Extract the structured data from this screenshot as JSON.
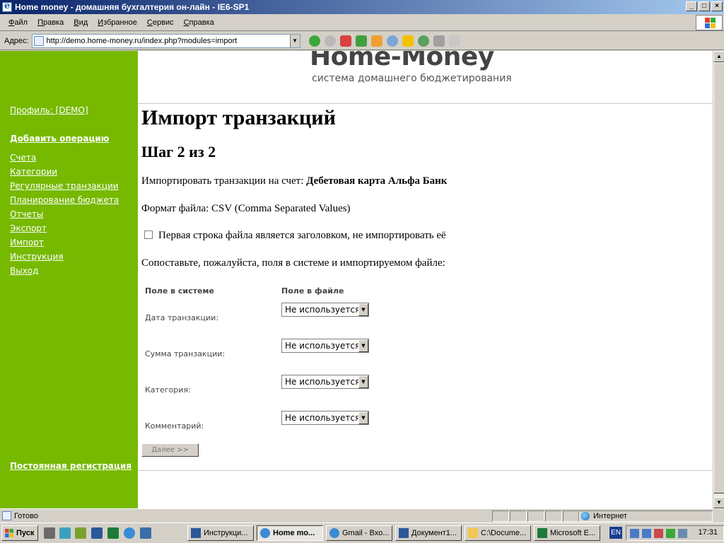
{
  "window": {
    "title": "Home money - домашняя бухгалтерия он-лайн - IE6-SP1",
    "controls": [
      "_",
      "□",
      "×"
    ]
  },
  "menubar": {
    "items": [
      "Файл",
      "Правка",
      "Вид",
      "Избранное",
      "Сервис",
      "Справка"
    ]
  },
  "addressbar": {
    "label": "Адрес:",
    "url": "http://demo.home-money.ru/index.php?modules=import"
  },
  "header": {
    "logo_title": "Home-Money",
    "logo_subtitle": "система домашнего бюджетирования"
  },
  "sidebar": {
    "profile_link": "Профиль: [DEMO]",
    "add_operation": "Добавить операцию",
    "items": [
      "Счета",
      "Категории",
      "Регулярные транзакции",
      "Планирование бюджета",
      "Отчеты",
      "Экспорт",
      "Импорт",
      "Инструкция",
      "Выход"
    ],
    "permanent_registration": "Постоянная регистрация",
    "color": "#76b900"
  },
  "main": {
    "title": "Импорт транзакций",
    "step": "Шаг 2 из 2",
    "account_label": "Импортировать транзакции на счет:",
    "account_value": "Дебетовая карта Альфа Банк",
    "format_line": "Формат файла: CSV (Comma Separated Values)",
    "header_checkbox_label": "Первая строка файла является заголовком, не импортировать её",
    "header_checkbox_checked": false,
    "mapping_prompt": "Сопоставьте, пожалуйста, поля в системе и импортируемом файле:",
    "mapping_headers": {
      "system": "Поле в системе",
      "file": "Поле в файле"
    },
    "mapping_rows": [
      {
        "field": "Дата транзакции:",
        "selected": "Не используется"
      },
      {
        "field": "Сумма транзакции:",
        "selected": "Не используется"
      },
      {
        "field": "Категория:",
        "selected": "Не используется"
      },
      {
        "field": "Комментарий:",
        "selected": "Не используется"
      }
    ],
    "next_button": "Далее >>"
  },
  "statusbar": {
    "status": "Готово",
    "zone": "Интернет"
  },
  "taskbar": {
    "start": "Пуск",
    "tasks": [
      {
        "label": "Инструкци...",
        "icon": "word-icon",
        "active": false
      },
      {
        "label": "Home mo...",
        "icon": "ie-icon",
        "active": true
      },
      {
        "label": "Gmail - Вхо...",
        "icon": "ie-icon",
        "active": false
      },
      {
        "label": "Документ1...",
        "icon": "word-icon",
        "active": false
      },
      {
        "label": "C:\\Docume...",
        "icon": "folder-icon",
        "active": false
      },
      {
        "label": "Microsoft E...",
        "icon": "excel-icon",
        "active": false
      }
    ],
    "language": "EN",
    "clock": "17:31"
  }
}
